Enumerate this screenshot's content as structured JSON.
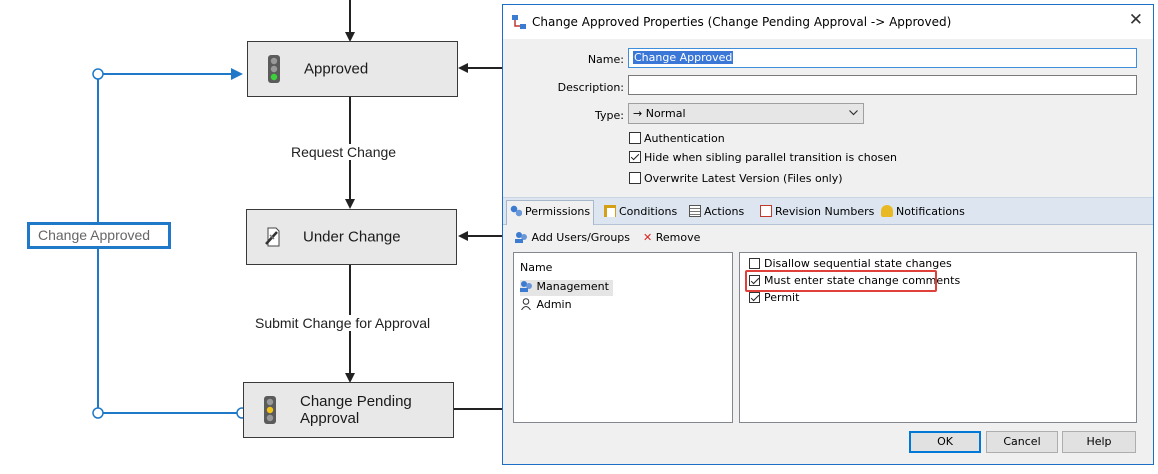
{
  "diagram": {
    "states": [
      {
        "label": "Approved",
        "icon": "traffic-light-green-icon"
      },
      {
        "label": "Under Change",
        "icon": "edit-document-icon"
      },
      {
        "label": "Change Pending\nApproval",
        "icon": "traffic-light-yellow-icon"
      }
    ],
    "transitions": {
      "request_change": "Request Change",
      "submit_change": "Submit Change for Approval",
      "change_approved": "Change Approved"
    },
    "colors": {
      "loop_line": "#1f78c8",
      "state_fill": "#e8e8e8",
      "arrow": "#222222"
    }
  },
  "dialog": {
    "title": "Change Approved Properties (Change Pending Approval -> Approved)",
    "close_glyph": "✕",
    "name_label": "Name:",
    "name_value": "Change Approved",
    "description_label": "Description:",
    "description_value": "",
    "type_label": "Type:",
    "type_value": "→ Normal",
    "checkboxes": [
      {
        "label": "Authentication",
        "checked": false
      },
      {
        "label": "Hide when sibling parallel transition is chosen",
        "checked": true
      },
      {
        "label": "Overwrite Latest Version (Files only)",
        "checked": false
      }
    ],
    "tabs": [
      "Permissions",
      "Conditions",
      "Actions",
      "Revision Numbers",
      "Notifications"
    ],
    "active_tab": "Permissions",
    "toolbar": {
      "add_label": "Add Users/Groups",
      "remove_label": "Remove"
    },
    "users_header": "Name",
    "users": [
      {
        "name": "Management",
        "icon": "group-icon"
      },
      {
        "name": "Admin",
        "icon": "user-icon"
      }
    ],
    "permissions": [
      {
        "label": "Disallow sequential state changes",
        "checked": false
      },
      {
        "label": "Must enter state change comments",
        "checked": true
      },
      {
        "label": "Permit",
        "checked": true
      }
    ],
    "buttons": {
      "ok": "OK",
      "cancel": "Cancel",
      "help": "Help"
    },
    "accent_color": "#0078d7",
    "highlight_color": "#e0403a"
  }
}
